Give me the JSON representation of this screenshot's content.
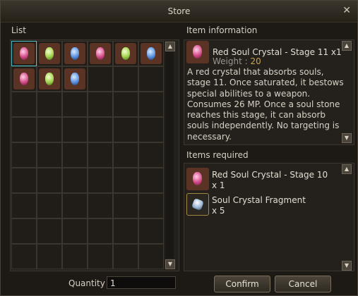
{
  "window": {
    "title": "Store"
  },
  "list": {
    "label": "List",
    "items": [
      {
        "color": "red",
        "icon": "red-soul-crystal-icon"
      },
      {
        "color": "green",
        "icon": "green-soul-crystal-icon"
      },
      {
        "color": "blue",
        "icon": "blue-soul-crystal-icon"
      },
      {
        "color": "red",
        "icon": "red-soul-crystal-icon"
      },
      {
        "color": "green",
        "icon": "green-soul-crystal-icon"
      },
      {
        "color": "blue",
        "icon": "blue-soul-crystal-icon"
      },
      {
        "color": "red",
        "icon": "red-soul-crystal-icon"
      },
      {
        "color": "green",
        "icon": "green-soul-crystal-icon"
      },
      {
        "color": "blue",
        "icon": "blue-soul-crystal-icon"
      }
    ],
    "selected_index": 0
  },
  "item_info": {
    "label": "Item information",
    "name": "Red Soul Crystal - Stage 11 x1",
    "weight_label": "Weight : ",
    "weight_value": "20",
    "description": "A red crystal that absorbs souls, stage 11. Once saturated, it bestows special abilities to a weapon. Consumes 26 MP. Once a soul stone reaches this stage, it can absorb souls independently. No targeting is necessary."
  },
  "items_required": {
    "label": "Items required",
    "items": [
      {
        "name": "Red Soul Crystal - Stage 10",
        "qty": "x 1",
        "icon": "red-soul-crystal-icon"
      },
      {
        "name": "Soul Crystal Fragment",
        "qty": "x 5",
        "icon": "soul-crystal-fragment-icon"
      }
    ]
  },
  "quantity": {
    "label": "Quantity",
    "value": "1"
  },
  "buttons": {
    "confirm": "Confirm",
    "cancel": "Cancel"
  },
  "colors": {
    "accent": "#4dc0c8",
    "weight_value": "#c8a54f"
  }
}
